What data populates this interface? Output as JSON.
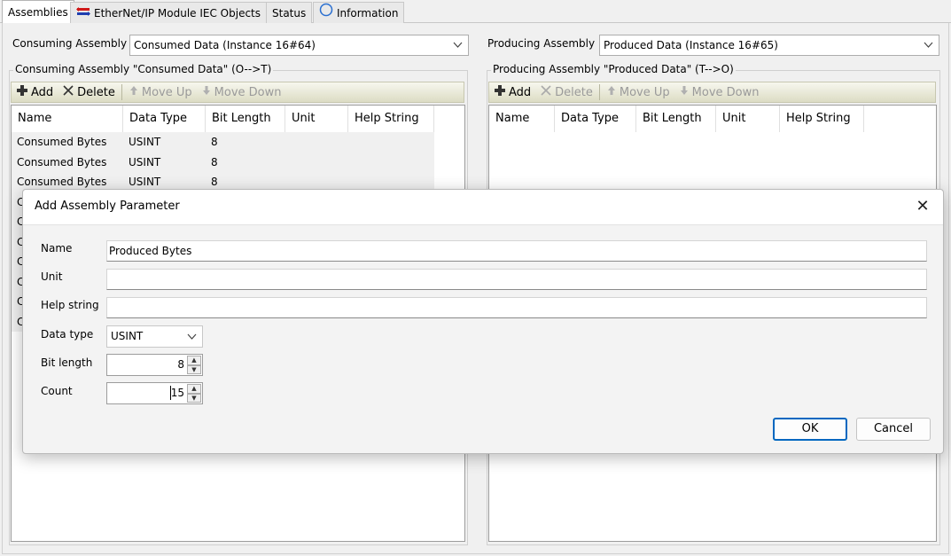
{
  "tabs": [
    {
      "label": "Assemblies",
      "icon": "none"
    },
    {
      "label": "EtherNet/IP Module IEC Objects",
      "icon": "ethernet-flag-icon"
    },
    {
      "label": "Status",
      "icon": "none"
    },
    {
      "label": "Information",
      "icon": "info-circle-icon"
    }
  ],
  "consuming": {
    "label": "Consuming Assembly",
    "selected": "Consumed Data (Instance 16#64)",
    "group_title": "Consuming Assembly \"Consumed Data\" (O-->T)",
    "toolbar": {
      "add": "Add",
      "delete": "Delete",
      "move_up": "Move Up",
      "move_down": "Move Down"
    },
    "columns": [
      "Name",
      "Data Type",
      "Bit Length",
      "Unit",
      "Help String"
    ],
    "rows": [
      [
        "Consumed Bytes",
        "USINT",
        "8",
        "",
        ""
      ],
      [
        "Consumed Bytes",
        "USINT",
        "8",
        "",
        ""
      ],
      [
        "Consumed Bytes",
        "USINT",
        "8",
        "",
        ""
      ],
      [
        "C",
        "",
        "",
        "",
        ""
      ],
      [
        "C",
        "",
        "",
        "",
        ""
      ],
      [
        "C",
        "",
        "",
        "",
        ""
      ],
      [
        "C",
        "",
        "",
        "",
        ""
      ],
      [
        "C",
        "",
        "",
        "",
        ""
      ],
      [
        "C",
        "",
        "",
        "",
        ""
      ],
      [
        "C",
        "",
        "",
        "",
        ""
      ]
    ]
  },
  "producing": {
    "label": "Producing Assembly",
    "selected": "Produced Data (Instance 16#65)",
    "group_title": "Producing Assembly \"Produced Data\" (T-->O)",
    "toolbar": {
      "add": "Add",
      "delete": "Delete",
      "move_up": "Move Up",
      "move_down": "Move Down"
    },
    "columns": [
      "Name",
      "Data Type",
      "Bit Length",
      "Unit",
      "Help String"
    ],
    "rows": []
  },
  "dialog": {
    "title": "Add Assembly Parameter",
    "close_glyph": "✕",
    "fields": {
      "name_label": "Name",
      "name_value": "Produced Bytes",
      "unit_label": "Unit",
      "unit_value": "",
      "help_label": "Help string",
      "help_value": "",
      "datatype_label": "Data type",
      "datatype_value": "USINT",
      "bitlength_label": "Bit length",
      "bitlength_value": "8",
      "count_label": "Count",
      "count_value": "15"
    },
    "ok": "OK",
    "cancel": "Cancel"
  },
  "colors": {
    "accent": "#0067c0",
    "toolbar_top": "#f7f7ee",
    "toolbar_bottom": "#dcdcc4",
    "flag_red": "#d01818",
    "flag_blue": "#1f3fb0"
  }
}
